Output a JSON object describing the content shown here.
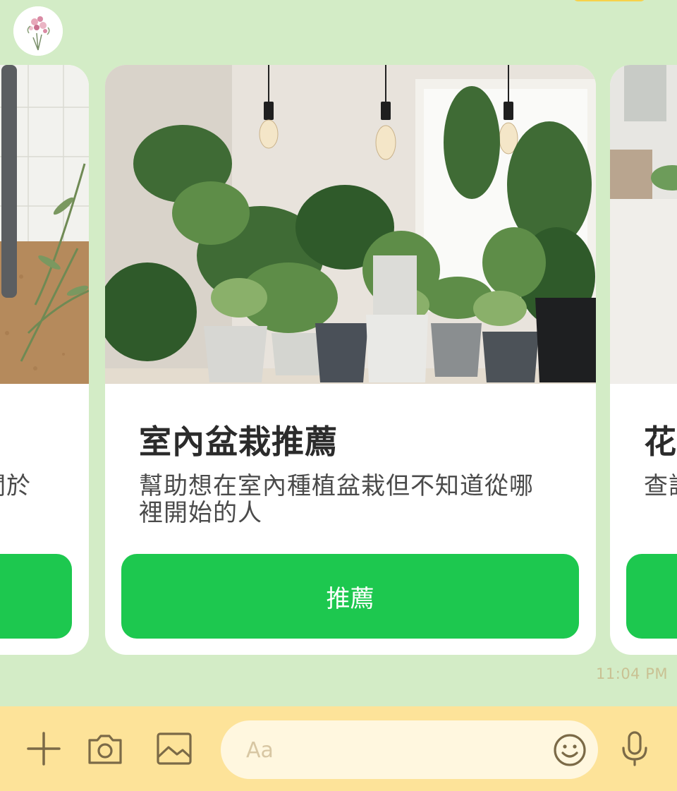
{
  "chat": {
    "timestamp": "11:04 PM"
  },
  "carousel": {
    "prev_card": {
      "desc_fragment": "關於"
    },
    "main_card": {
      "title": "室內盆栽推薦",
      "description": "幫助想在室內種植盆栽但不知道從哪裡開始的人",
      "button_label": "推薦"
    },
    "next_card": {
      "title_fragment": "花",
      "desc_fragment": "查詢"
    }
  },
  "input_bar": {
    "placeholder": "Aa",
    "icons": [
      "plus-icon",
      "camera-icon",
      "image-icon",
      "emoji-icon",
      "microphone-icon"
    ]
  },
  "colors": {
    "chat_background": "#d3ecc6",
    "button_green": "#1dc84f",
    "input_bar": "#fde399",
    "input_field": "#fff7df"
  }
}
